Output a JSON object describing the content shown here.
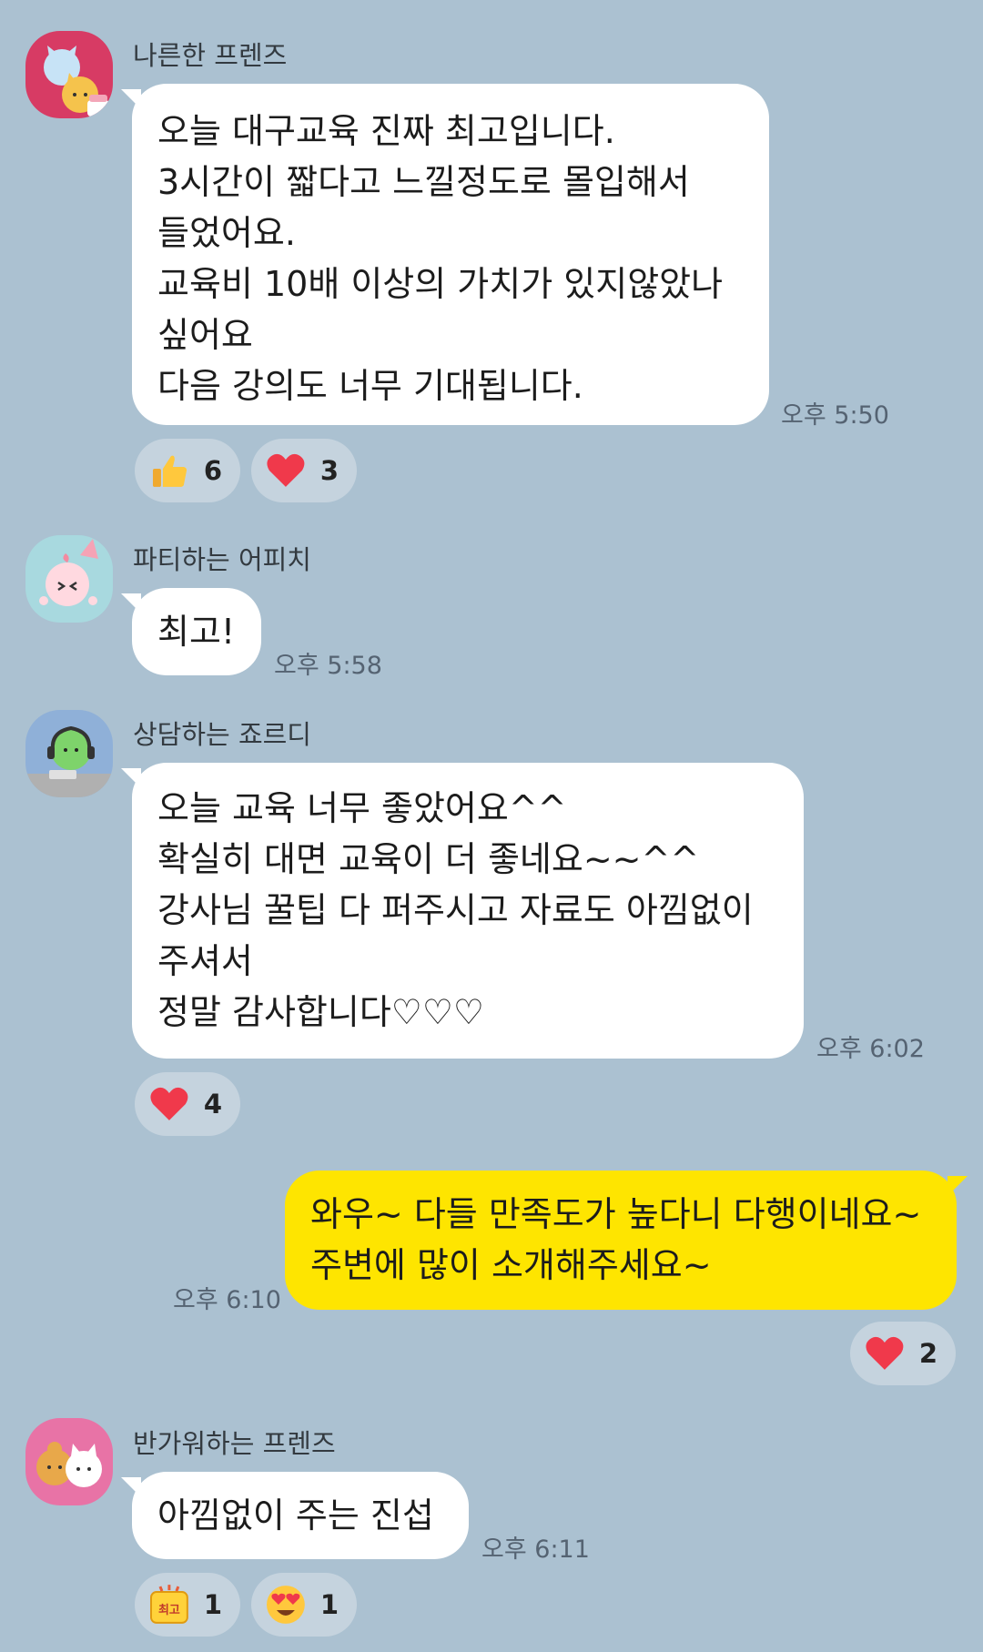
{
  "messages": [
    {
      "sender": "나른한 프렌즈",
      "lines": [
        "오늘 대구교육 진짜 최고입니다.",
        "3시간이 짧다고 느낄정도로 몰입해서",
        "들었어요.",
        "교육비 10배 이상의 가치가 있지않았나",
        "싶어요",
        "다음 강의도 너무 기대됩니다."
      ],
      "time": "오후 5:50",
      "reactions": [
        {
          "icon": "thumbs-up-icon",
          "count": "6"
        },
        {
          "icon": "heart-icon",
          "count": "3"
        }
      ]
    },
    {
      "sender": "파티하는 어피치",
      "lines": [
        "최고!"
      ],
      "time": "오후 5:58",
      "reactions": []
    },
    {
      "sender": "상담하는 죠르디",
      "lines": [
        "오늘 교육 너무 좋았어요^^",
        "확실히 대면 교육이 더 좋네요~~^^",
        "강사님 꿀팁 다 퍼주시고 자료도 아낌없이",
        "주셔서",
        "정말 감사합니다♡♡♡"
      ],
      "time": "오후 6:02",
      "reactions": [
        {
          "icon": "heart-icon",
          "count": "4"
        }
      ]
    },
    {
      "sender": "",
      "lines": [
        "와우~  다들 만족도가 높다니 다행이네요~",
        "주변에 많이 소개해주세요~"
      ],
      "time": "오후 6:10",
      "reactions": [
        {
          "icon": "heart-icon",
          "count": "2"
        }
      ]
    },
    {
      "sender": "반가워하는 프렌즈",
      "lines": [
        "아낌없이 주는 진섭"
      ],
      "time": "오후 6:11",
      "reactions": [
        {
          "icon": "best-sticker-icon",
          "label": "최고",
          "count": "1"
        },
        {
          "icon": "heart-eyes-emoji-icon",
          "count": "1"
        }
      ]
    }
  ],
  "colors": {
    "background": "#abc1d1",
    "incoming_bubble": "#ffffff",
    "outgoing_bubble": "#fee500",
    "reaction_pill": "#c5d3de",
    "heart": "#f0394b"
  }
}
